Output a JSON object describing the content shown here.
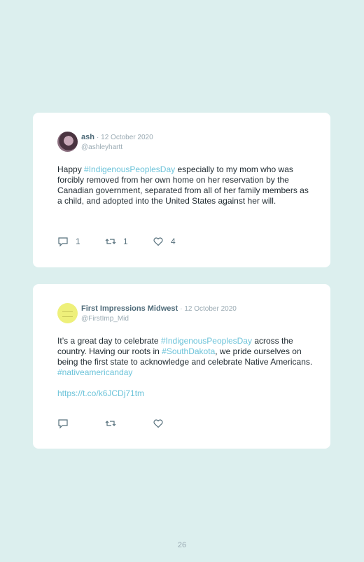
{
  "tweets": [
    {
      "name": "ash",
      "date": "· 12 October 2020",
      "handle": "@ashleyhartt",
      "text_parts": [
        "Happy ",
        "#IndigenousPeoplesDay",
        " especially to my mom who was forcibly removed from her own home on her reservation by the Canadian government, separated from all of her family members as a child, and adopted into the United States against her will."
      ],
      "replies": "1",
      "retweets": "1",
      "likes": "4"
    },
    {
      "name": "First Impressions Midwest",
      "date": "· 12 October 2020",
      "handle": "@FirstImp_Mid",
      "text_parts": [
        "It’s a great day to celebrate ",
        "#IndigenousPeoplesDay",
        " across the country. Having our roots in ",
        "#SouthDakota",
        ", we pride ourselves on being the first state to acknowledge and celebrate Native Americans. ",
        "#nativeamericanday"
      ],
      "link": "https://t.co/k6JCDj71tm",
      "replies": "",
      "retweets": "",
      "likes": ""
    }
  ],
  "icons": {
    "reply": "speech-bubble-icon",
    "retweet": "retweet-icon",
    "like": "heart-icon"
  },
  "colors": {
    "background": "#dcefee",
    "hashtag": "#6cc3d9",
    "name": "#4f6b79"
  },
  "page_number": "26"
}
